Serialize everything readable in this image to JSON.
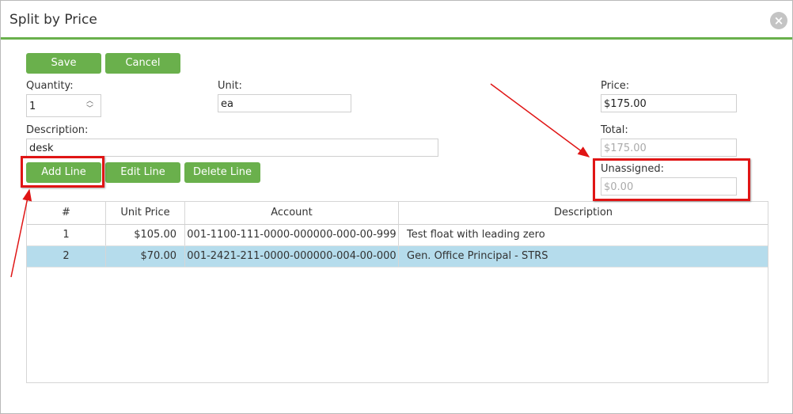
{
  "dialog": {
    "title": "Split by Price",
    "close_symbol": "×"
  },
  "toolbar": {
    "save_label": "Save",
    "cancel_label": "Cancel"
  },
  "form": {
    "quantity_label": "Quantity:",
    "quantity_value": "1",
    "unit_label": "Unit:",
    "unit_value": "ea",
    "price_label": "Price:",
    "price_value": "$175.00",
    "description_label": "Description:",
    "description_value": "desk",
    "total_label": "Total:",
    "total_value": "$175.00",
    "unassigned_label": "Unassigned:",
    "unassigned_value": "$0.00"
  },
  "line_actions": {
    "add_label": "Add Line",
    "edit_label": "Edit Line",
    "delete_label": "Delete Line"
  },
  "grid": {
    "columns": [
      "#",
      "Unit Price",
      "Account",
      "Description"
    ],
    "rows": [
      {
        "num": "1",
        "unit_price": "$105.00",
        "account": "001-1100-111-0000-000000-000-00-999",
        "description": "Test float with leading zero"
      },
      {
        "num": "2",
        "unit_price": "$70.00",
        "account": "001-2421-211-0000-000000-004-00-000",
        "description": "Gen. Office Principal - STRS"
      }
    ]
  },
  "colors": {
    "accent_green": "#6ab04c",
    "highlight_red": "#e01515",
    "selected_row": "#b5dcec"
  }
}
